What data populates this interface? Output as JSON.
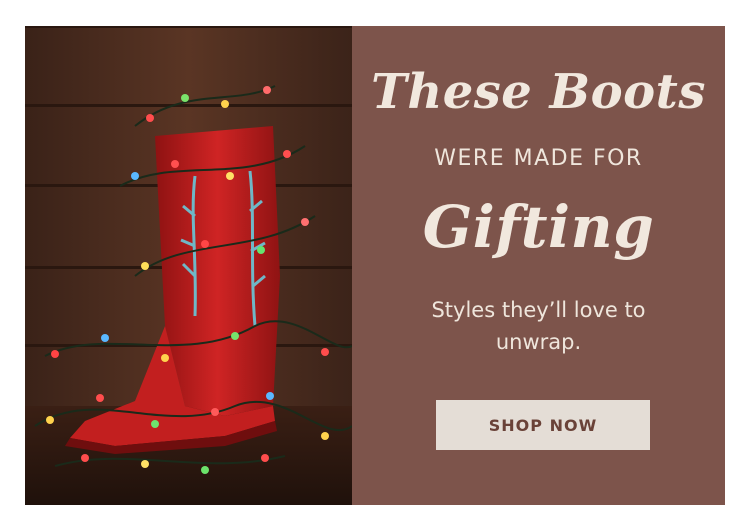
{
  "banner": {
    "headline_line1": "These Boots",
    "headline_line2": "WERE MADE FOR",
    "headline_line3": "Gifting",
    "subtext": "Styles they’ll love to unwrap.",
    "cta_label": "SHOP NOW"
  },
  "photo": {
    "subject": "red-cowboy-boot-with-string-lights-icon"
  },
  "colors": {
    "panel": "#7d544b",
    "button_bg": "#e4ddd6",
    "button_text": "#6a4238",
    "headline": "#f1e8de",
    "boot": "#b51c1c"
  }
}
